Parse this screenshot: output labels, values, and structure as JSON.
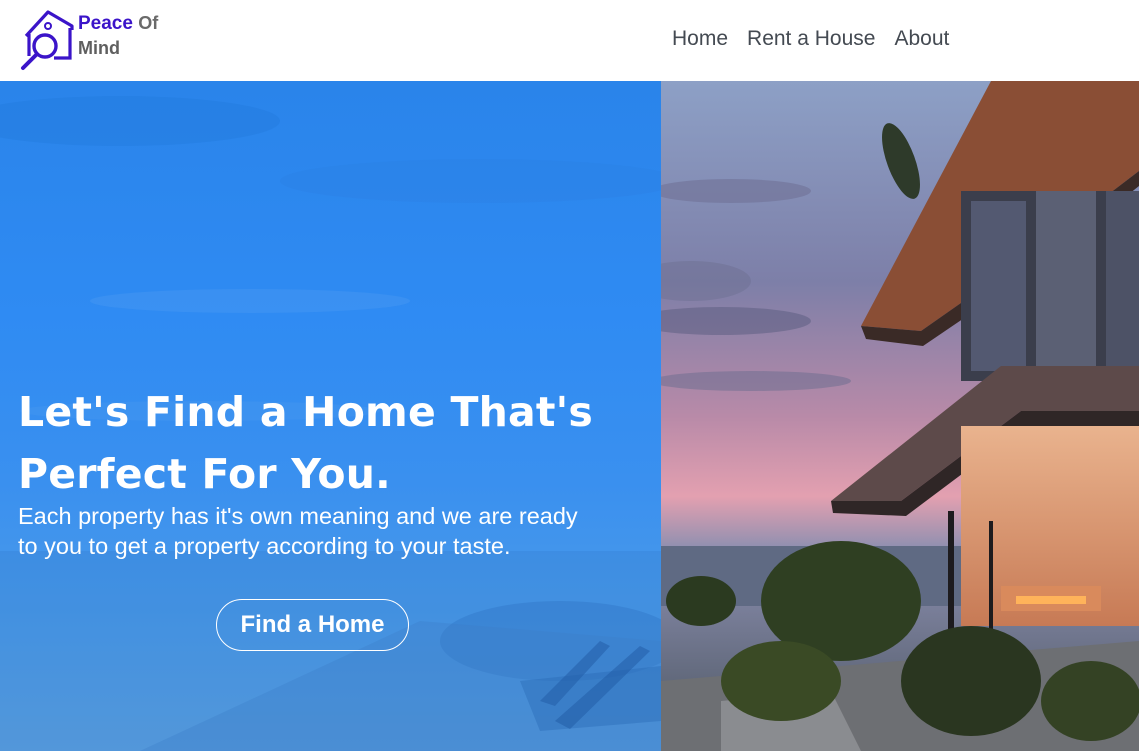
{
  "brand": {
    "line1_main": "Peace",
    "line1_suffix": "Of",
    "line2": "Mind",
    "icon": "house-search-icon",
    "colors": {
      "primary": "#3b14c9",
      "secondary": "#5f5f5f"
    }
  },
  "nav": {
    "items": [
      {
        "label": "Home"
      },
      {
        "label": "Rent a House"
      },
      {
        "label": "About"
      }
    ]
  },
  "hero": {
    "headline_line1": "Let's Find a Home That's",
    "headline_line2": "Perfect For You.",
    "subtext_line1": "Each property has it's own meaning and we are ready",
    "subtext_line2": "to you to get a property according to your taste.",
    "cta_label": "Find a Home",
    "background_image": "modern-villa-at-dusk",
    "overlay_color": "#2f8bf3"
  }
}
